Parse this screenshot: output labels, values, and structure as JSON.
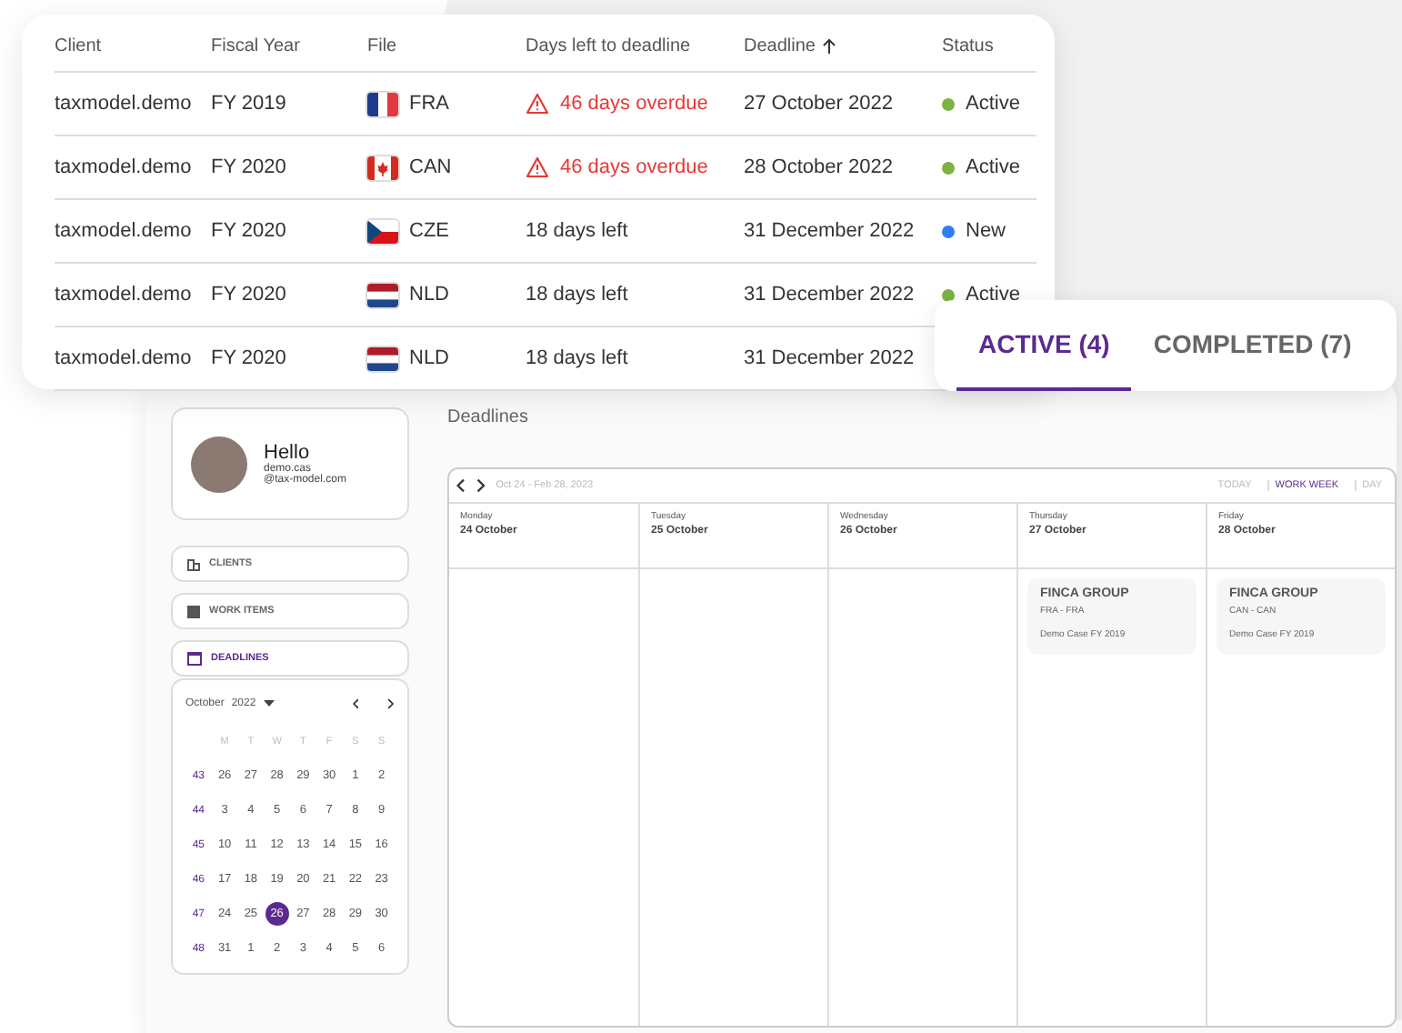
{
  "table": {
    "columns": [
      {
        "label": "Client",
        "sorted": false
      },
      {
        "label": "Fiscal Year",
        "sorted": false
      },
      {
        "label": "File",
        "sorted": false
      },
      {
        "label": "Days left to deadline",
        "sorted": false
      },
      {
        "label": "Deadline",
        "sorted": true
      },
      {
        "label": "Status",
        "sorted": false
      }
    ],
    "rows": [
      {
        "client": "taxmodel.demo",
        "fiscal_year": "FY 2019",
        "kind": "fra",
        "file": "FRA",
        "days": "46 days overdue",
        "overdue": true,
        "deadline": "27 October 2022",
        "status": "Active",
        "color": "#7cb342"
      },
      {
        "client": "taxmodel.demo",
        "fiscal_year": "FY 2020",
        "kind": "can",
        "file": "CAN",
        "days": "46 days overdue",
        "overdue": true,
        "deadline": "28 October 2022",
        "status": "Active",
        "color": "#7cb342"
      },
      {
        "client": "taxmodel.demo",
        "fiscal_year": "FY 2020",
        "kind": "cze",
        "file": "CZE",
        "days": "18 days left",
        "overdue": false,
        "deadline": "31 December 2022",
        "status": "New",
        "color": "#2f7ff0"
      },
      {
        "client": "taxmodel.demo",
        "fiscal_year": "FY 2020",
        "kind": "nld",
        "file": "NLD",
        "days": "18 days left",
        "overdue": false,
        "deadline": "31 December 2022",
        "status": "Active",
        "color": "#7cb342"
      },
      {
        "client": "taxmodel.demo",
        "fiscal_year": "FY 2020",
        "kind": "nld",
        "file": "NLD",
        "days": "18 days left",
        "overdue": false,
        "deadline": "31 December 2022"
      }
    ]
  },
  "tabs": [
    {
      "label": "ACTIVE (4)",
      "selected": true
    },
    {
      "label": "COMPLETED (7)",
      "selected": false
    }
  ],
  "profile": {
    "greeting": "Hello",
    "name": "demo.cas",
    "email": "@tax-model.com"
  },
  "nav": [
    {
      "label": "CLIENTS",
      "kind": "clients",
      "selected": false
    },
    {
      "label": "WORK ITEMS",
      "kind": "work",
      "selected": false
    },
    {
      "label": "DEADLINES",
      "kind": "deadlines",
      "selected": true
    }
  ],
  "mini_calendar": {
    "month": "October",
    "year": "2022",
    "weekdays": [
      "M",
      "T",
      "W",
      "T",
      "F",
      "S",
      "S"
    ],
    "weeks": [
      {
        "week": "43",
        "days": [
          {
            "d": "26",
            "selected": false
          },
          {
            "d": "27",
            "selected": false
          },
          {
            "d": "28",
            "selected": false
          },
          {
            "d": "29",
            "selected": false
          },
          {
            "d": "30",
            "selected": false
          },
          {
            "d": "1",
            "selected": false
          },
          {
            "d": "2",
            "selected": false
          }
        ]
      },
      {
        "week": "44",
        "days": [
          {
            "d": "3",
            "selected": false
          },
          {
            "d": "4",
            "selected": false
          },
          {
            "d": "5",
            "selected": false
          },
          {
            "d": "6",
            "selected": false
          },
          {
            "d": "7",
            "selected": false
          },
          {
            "d": "8",
            "selected": false
          },
          {
            "d": "9",
            "selected": false
          }
        ]
      },
      {
        "week": "45",
        "days": [
          {
            "d": "10",
            "selected": false
          },
          {
            "d": "11",
            "selected": false
          },
          {
            "d": "12",
            "selected": false
          },
          {
            "d": "13",
            "selected": false
          },
          {
            "d": "14",
            "selected": false
          },
          {
            "d": "15",
            "selected": false
          },
          {
            "d": "16",
            "selected": false
          }
        ]
      },
      {
        "week": "46",
        "days": [
          {
            "d": "17",
            "selected": false
          },
          {
            "d": "18",
            "selected": false
          },
          {
            "d": "19",
            "selected": false
          },
          {
            "d": "20",
            "selected": false
          },
          {
            "d": "21",
            "selected": false
          },
          {
            "d": "22",
            "selected": false
          },
          {
            "d": "23",
            "selected": false
          }
        ]
      },
      {
        "week": "47",
        "days": [
          {
            "d": "24",
            "selected": false
          },
          {
            "d": "25",
            "selected": false
          },
          {
            "d": "26",
            "selected": true
          },
          {
            "d": "27",
            "selected": false
          },
          {
            "d": "28",
            "selected": false
          },
          {
            "d": "29",
            "selected": false
          },
          {
            "d": "30",
            "selected": false
          }
        ]
      },
      {
        "week": "48",
        "days": [
          {
            "d": "31",
            "selected": false
          },
          {
            "d": "1",
            "selected": false
          },
          {
            "d": "2",
            "selected": false
          },
          {
            "d": "3",
            "selected": false
          },
          {
            "d": "4",
            "selected": false
          },
          {
            "d": "5",
            "selected": false
          },
          {
            "d": "6",
            "selected": false
          }
        ]
      }
    ]
  },
  "deadlines": {
    "title": "Deadlines",
    "range": "Oct 24 - Feb 28, 2023",
    "views": [
      {
        "label": "TODAY",
        "selected": false
      },
      {
        "label": "WORK WEEK",
        "selected": true
      },
      {
        "label": "DAY",
        "selected": false
      }
    ],
    "days": [
      {
        "weekday": "Monday",
        "date": "24 October"
      },
      {
        "weekday": "Tuesday",
        "date": "25 October"
      },
      {
        "weekday": "Wednesday",
        "date": "26 October"
      },
      {
        "weekday": "Thursday",
        "date": "27 October",
        "events": [
          {
            "title": "FINCA GROUP",
            "files": "FRA - FRA",
            "case": "Demo Case FY 2019"
          }
        ]
      },
      {
        "weekday": "Friday",
        "date": "28 October",
        "events": [
          {
            "title": "FINCA GROUP",
            "files": "CAN - CAN",
            "case": "Demo Case FY 2019"
          }
        ]
      }
    ]
  }
}
